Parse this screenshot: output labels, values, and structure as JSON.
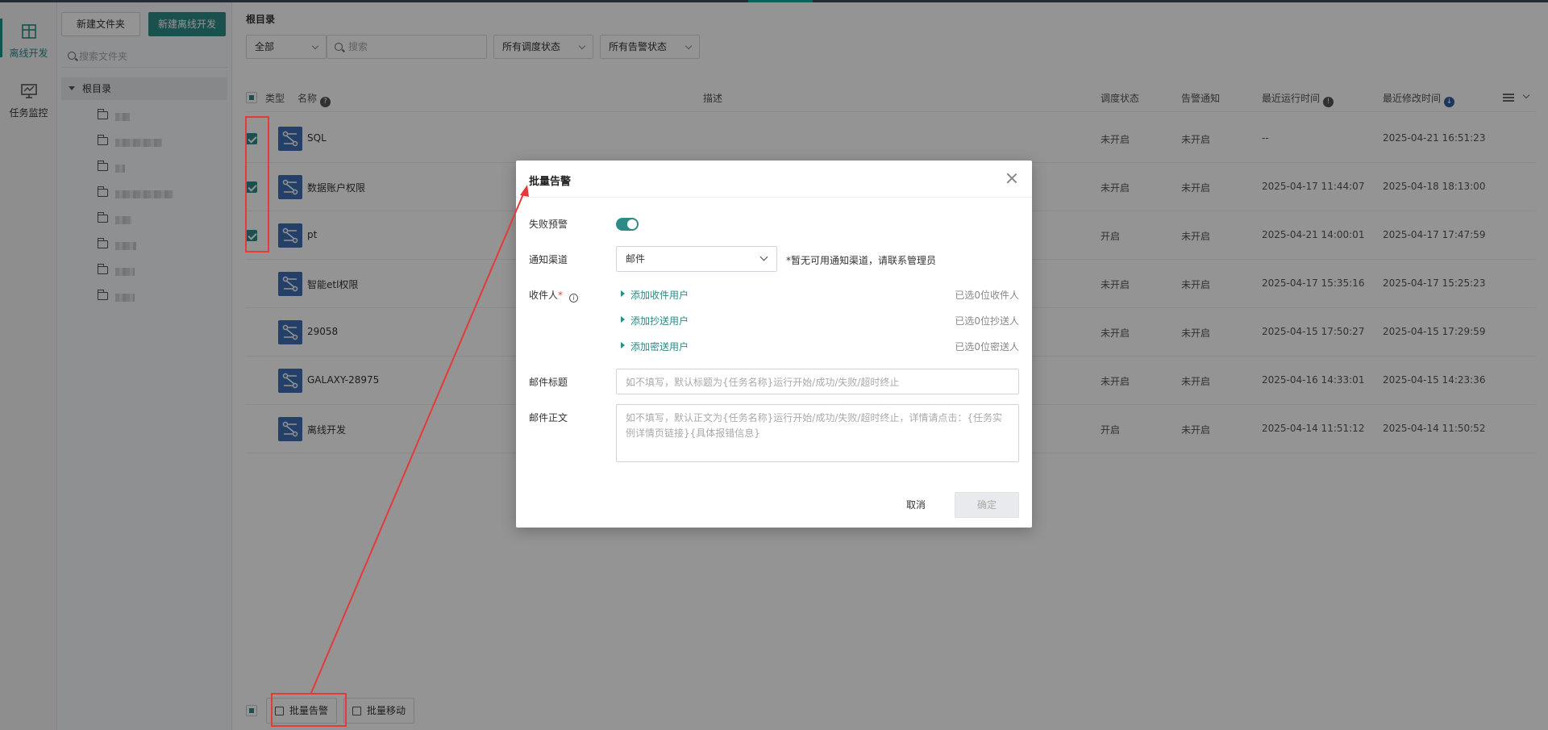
{
  "rail": {
    "items": [
      {
        "label": "离线开发",
        "icon": "table-icon",
        "active": true
      },
      {
        "label": "任务监控",
        "icon": "monitor-icon",
        "active": false
      }
    ]
  },
  "tree": {
    "new_folder_label": "新建文件夹",
    "new_offline_label": "新建离线开发",
    "search_placeholder": "搜索文件夹",
    "root_label": "根目录",
    "folder_count": 8
  },
  "main": {
    "breadcrumb": "根目录",
    "filters": {
      "type_value": "全部",
      "search_placeholder": "搜索",
      "schedule_status": "所有调度状态",
      "alert_status": "所有告警状态"
    },
    "columns": {
      "type": "类型",
      "name": "名称",
      "desc": "描述",
      "schedule": "调度状态",
      "alert": "告警通知",
      "last_run": "最近运行时间",
      "last_modified": "最近修改时间"
    },
    "rows": [
      {
        "name": "SQL",
        "schedule": "未开启",
        "alert": "未开启",
        "last_run": "--",
        "last_modified": "2025-04-21 16:51:23",
        "checked": true
      },
      {
        "name": "数据账户权限",
        "schedule": "未开启",
        "alert": "未开启",
        "last_run": "2025-04-17 11:44:07",
        "last_modified": "2025-04-18 18:13:00",
        "checked": true
      },
      {
        "name": "pt",
        "schedule": "开启",
        "alert": "未开启",
        "last_run": "2025-04-21 14:00:01",
        "last_modified": "2025-04-17 17:47:59",
        "checked": true
      },
      {
        "name": "智能etl权限",
        "schedule": "未开启",
        "alert": "未开启",
        "last_run": "2025-04-17 15:35:16",
        "last_modified": "2025-04-17 15:25:23",
        "checked": false
      },
      {
        "name": "29058",
        "schedule": "未开启",
        "alert": "未开启",
        "last_run": "2025-04-15 17:50:27",
        "last_modified": "2025-04-15 17:29:59",
        "checked": false
      },
      {
        "name": "GALAXY-28975",
        "schedule": "未开启",
        "alert": "未开启",
        "last_run": "2025-04-16 14:33:01",
        "last_modified": "2025-04-15 14:23:36",
        "checked": false
      },
      {
        "name": "离线开发",
        "schedule": "开启",
        "alert": "未开启",
        "last_run": "2025-04-14 11:51:12",
        "last_modified": "2025-04-14 11:50:52",
        "checked": false
      }
    ],
    "bulk_alert_label": "批量告警",
    "bulk_move_label": "批量移动"
  },
  "modal": {
    "title": "批量告警",
    "fail_alert_label": "失败预警",
    "fail_alert_on": true,
    "channel_label": "通知渠道",
    "channel_value": "邮件",
    "channel_note": "*暂无可用通知渠道，请联系管理员",
    "recipient_label": "收件人",
    "required_mark": "*",
    "add_to": "添加收件用户",
    "add_cc": "添加抄送用户",
    "add_bcc": "添加密送用户",
    "count_to": "已选0位收件人",
    "count_cc": "已选0位抄送人",
    "count_bcc": "已选0位密送人",
    "subject_label": "邮件标题",
    "subject_placeholder": "如不填写，默认标题为{任务名称}运行开始/成功/失败/超时终止",
    "body_label": "邮件正文",
    "body_placeholder": "如不填写，默认正文为{任务名称}运行开始/成功/失败/超时终止，详情请点击：{任务实例详情页链接}{具体报错信息}",
    "cancel_label": "取消",
    "ok_label": "确定"
  },
  "colors": {
    "accent": "#2d8a86",
    "annotation": "#e53a3a",
    "type_icon": "#3f6fb3"
  }
}
